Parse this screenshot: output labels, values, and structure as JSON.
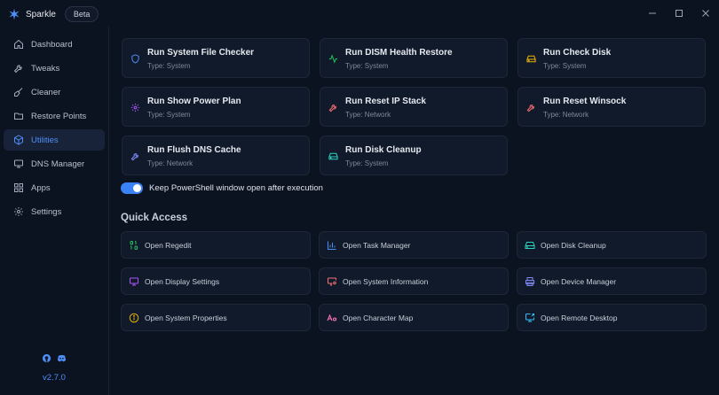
{
  "titlebar": {
    "app_name": "Sparkle",
    "badge": "Beta"
  },
  "sidebar": {
    "items": [
      {
        "label": "Dashboard",
        "icon": "home-icon"
      },
      {
        "label": "Tweaks",
        "icon": "wrench-icon"
      },
      {
        "label": "Cleaner",
        "icon": "broom-icon"
      },
      {
        "label": "Restore Points",
        "icon": "folder-icon"
      },
      {
        "label": "Utilities",
        "icon": "box-icon",
        "active": true
      },
      {
        "label": "DNS Manager",
        "icon": "monitor-icon"
      },
      {
        "label": "Apps",
        "icon": "grid-icon"
      },
      {
        "label": "Settings",
        "icon": "gear-icon"
      }
    ],
    "version": "v2.7.0"
  },
  "utilities": [
    {
      "title": "Run System File Checker",
      "type": "Type: System",
      "icon": "shield-icon",
      "color": "#4f8ef7"
    },
    {
      "title": "Run DISM Health Restore",
      "type": "Type: System",
      "icon": "activity-icon",
      "color": "#22c55e"
    },
    {
      "title": "Run Check Disk",
      "type": "Type: System",
      "icon": "hard-drive-icon",
      "color": "#eab308"
    },
    {
      "title": "Run Show Power Plan",
      "type": "Type: System",
      "icon": "gear-icon",
      "color": "#a855f7"
    },
    {
      "title": "Run Reset IP Stack",
      "type": "Type: Network",
      "icon": "wrench-icon",
      "color": "#f87171"
    },
    {
      "title": "Run Reset Winsock",
      "type": "Type: Network",
      "icon": "wrench-icon",
      "color": "#f87171"
    },
    {
      "title": "Run Flush DNS Cache",
      "type": "Type: Network",
      "icon": "wrench-icon",
      "color": "#818cf8"
    },
    {
      "title": "Run Disk Cleanup",
      "type": "Type: System",
      "icon": "hard-drive-icon",
      "color": "#2dd4bf"
    }
  ],
  "toggle": {
    "label": "Keep PowerShell window open after execution",
    "on": true
  },
  "quick_access": {
    "title": "Quick Access",
    "items": [
      {
        "label": "Open Regedit",
        "icon": "binary-icon",
        "color": "#22c55e"
      },
      {
        "label": "Open Task Manager",
        "icon": "bar-chart-icon",
        "color": "#4f8ef7"
      },
      {
        "label": "Open Disk Cleanup",
        "icon": "hard-drive-icon",
        "color": "#2dd4bf"
      },
      {
        "label": "Open Display Settings",
        "icon": "monitor-icon",
        "color": "#a855f7"
      },
      {
        "label": "Open System Information",
        "icon": "monitor-cog-icon",
        "color": "#f87171"
      },
      {
        "label": "Open Device Manager",
        "icon": "printer-icon",
        "color": "#818cf8"
      },
      {
        "label": "Open System Properties",
        "icon": "info-icon",
        "color": "#eab308"
      },
      {
        "label": "Open Character Map",
        "icon": "case-icon",
        "color": "#f472b6"
      },
      {
        "label": "Open Remote Desktop",
        "icon": "screen-share-icon",
        "color": "#38bdf8"
      }
    ]
  }
}
